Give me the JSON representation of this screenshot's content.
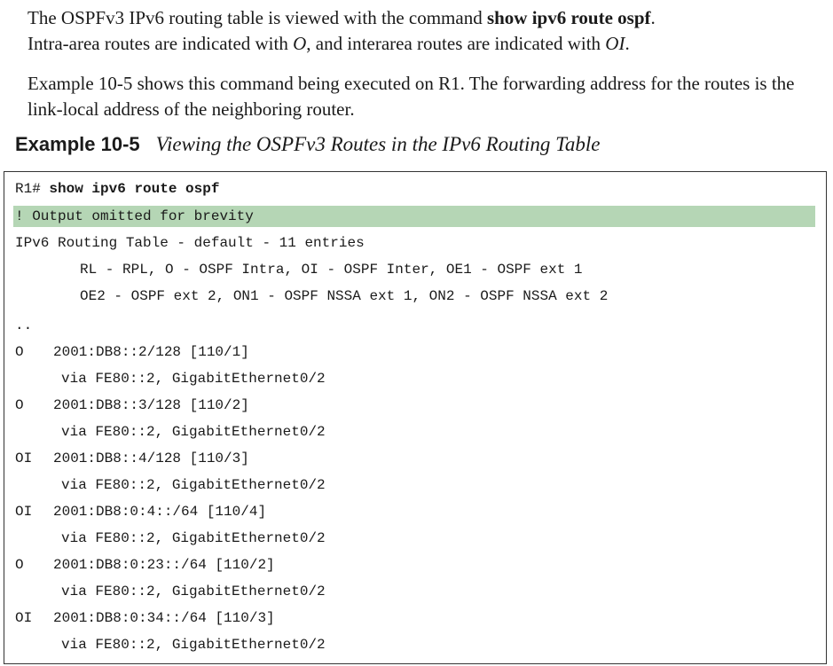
{
  "intro": {
    "p1_a": "The OSPFv3 IPv6 routing table is viewed with the command ",
    "p1_cmd": "show ipv6 route ospf",
    "p1_b": ".",
    "p1_c": "Intra-area routes are indicated with ",
    "p1_o": "O",
    "p1_d": ", and interarea routes are indicated with ",
    "p1_oi": "OI",
    "p1_e": ".",
    "p2": "Example 10-5 shows this command being executed on R1. The forwarding address for the routes is the link-local address of the neighboring router."
  },
  "example": {
    "label": "Example 10-5",
    "title": "Viewing the OSPFv3 Routes in the IPv6 Routing Table"
  },
  "code": {
    "prompt": "R1#",
    "command": "show ipv6 route ospf",
    "omitted": "! Output omitted for brevity",
    "table_header": "IPv6 Routing Table - default - 11 entries",
    "legend1": "RL - RPL, O - OSPF Intra, OI - OSPF Inter, OE1 - OSPF ext 1",
    "legend2": "OE2 - OSPF ext 2, ON1 - OSPF NSSA ext 1, ON2 - OSPF NSSA ext 2",
    "ellipsis": "..",
    "routes": [
      {
        "code": "O",
        "prefix": "2001:DB8::2/128 [110/1]",
        "via": "via FE80::2, GigabitEthernet0/2"
      },
      {
        "code": "O",
        "prefix": "2001:DB8::3/128 [110/2]",
        "via": "via FE80::2, GigabitEthernet0/2"
      },
      {
        "code": "OI",
        "prefix": "2001:DB8::4/128 [110/3]",
        "via": "via FE80::2, GigabitEthernet0/2"
      },
      {
        "code": "OI",
        "prefix": "2001:DB8:0:4::/64 [110/4]",
        "via": "via FE80::2, GigabitEthernet0/2"
      },
      {
        "code": "O",
        "prefix": "2001:DB8:0:23::/64 [110/2]",
        "via": "via FE80::2, GigabitEthernet0/2"
      },
      {
        "code": "OI",
        "prefix": "2001:DB8:0:34::/64 [110/3]",
        "via": "via FE80::2, GigabitEthernet0/2"
      }
    ]
  },
  "colors": {
    "highlight": "#b5d6b5",
    "text": "#1a1a1a",
    "border": "#333333"
  }
}
